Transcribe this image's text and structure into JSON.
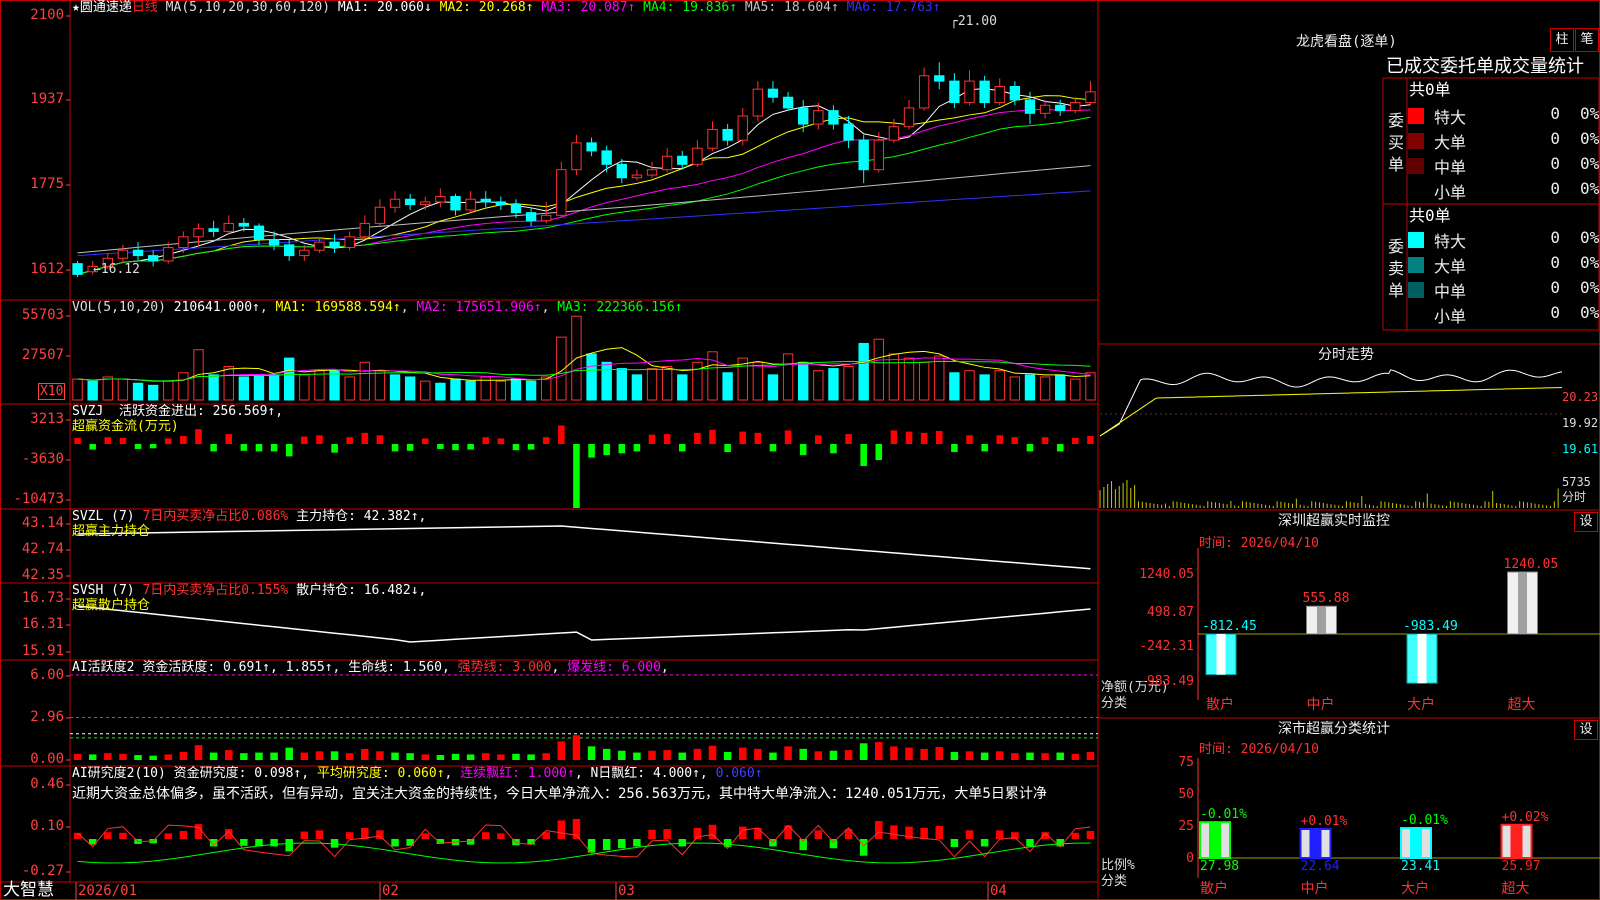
{
  "app": {
    "brand": "大智慧"
  },
  "stock": {
    "name": "★圆通速递",
    "period": "日线",
    "ma_label": "MA(5,10,20,30,60,120)",
    "ma_values": [
      {
        "key": "MA1",
        "value": "20.060",
        "dir": "down",
        "color": "#ffffff"
      },
      {
        "key": "MA2",
        "value": "20.268",
        "dir": "up",
        "color": "#ffff00"
      },
      {
        "key": "MA3",
        "value": "20.087",
        "dir": "up",
        "color": "#ff00ff"
      },
      {
        "key": "MA4",
        "value": "19.836",
        "dir": "up",
        "color": "#00ff00"
      },
      {
        "key": "MA5",
        "value": "18.604",
        "dir": "up",
        "color": "#c0c0c0"
      },
      {
        "key": "MA6",
        "value": "17.763",
        "dir": "up",
        "color": "#3030ff"
      }
    ],
    "high_marker": "21.00",
    "low_marker": "←16.12"
  },
  "colors": {
    "up": "#ff3030",
    "down": "#00ffff",
    "border": "#c00000",
    "yaxis": "#ff4040"
  },
  "panes": {
    "vol": {
      "label": "VOL(5,10,20)",
      "value": "210641.000↑",
      "ma1": "MA1: 169588.594↑",
      "ma2": "MA2: 175651.906↑",
      "ma3": "MA3: 222366.156↑",
      "unit": "X10"
    },
    "svzj": {
      "label": "SVZJ",
      "desc": "活跃资金进出: 256.569↑",
      "sub": "超赢资金流(万元)"
    },
    "svzl": {
      "label": "SVZL (7)",
      "desc": "7日内买卖净占比0.086%",
      "hold": "主力持仓: 42.382↑",
      "sub": "超赢主力持仓"
    },
    "svsh": {
      "label": "SVSH (7)",
      "desc": "7日内买卖净占比0.155%",
      "hold": "散户持仓: 16.482↓",
      "sub": "超赢散户持仓"
    },
    "ai1": {
      "label": "AI活跃度2",
      "desc": "资金活跃度: 0.691↑",
      "v2": "1.855",
      "v3": "生命线: 1.560",
      "v4": "强势线: 3.000",
      "v5": "爆发线: 6.000"
    },
    "ai2": {
      "label": "AI研究度2(10)",
      "desc": "资金研究度: 0.098↑",
      "v2": "平均研究度: 0.060↑",
      "v3": "连续飘红: 1.000↑",
      "v4": "N日飘红: 4.000↑",
      "v5": "0.060↑",
      "comment": "近期大资金总体偏多，虽不活跃，但有异动，宜关注大资金的持续性，今日大单净流入：256.563万元，其中特大单净流入：1240.051万元，大单5日累计净"
    }
  },
  "yaxis": {
    "price": [
      "2100",
      "1937",
      "1775",
      "1612"
    ],
    "vol": [
      "55703",
      "27507"
    ],
    "svzj": [
      "3213",
      "-3630",
      "-10473"
    ],
    "svzl": [
      "43.14",
      "42.74",
      "42.35"
    ],
    "svsh": [
      "16.73",
      "16.31",
      "15.91"
    ],
    "ai1": [
      "6.00",
      "2.96",
      "0.00"
    ],
    "ai2": [
      "0.46",
      "0.10",
      "-0.27"
    ]
  },
  "xaxis": [
    "2026/01",
    "02",
    "03",
    "04"
  ],
  "side": {
    "title": "龙虎看盘(逐单)",
    "btn_zhu": "柱",
    "btn_bi": "笔",
    "stats_header": "已成交委托单成交量统计",
    "buy": {
      "side_label": [
        "委",
        "买",
        "单"
      ],
      "total": "共0单",
      "rows": [
        {
          "label": "特大",
          "value": "0",
          "pct": "0%",
          "color": "#ff0000"
        },
        {
          "label": "大单",
          "value": "0",
          "pct": "0%",
          "color": "#800000"
        },
        {
          "label": "中单",
          "value": "0",
          "pct": "0%",
          "color": "#600000"
        },
        {
          "label": "小单",
          "value": "0",
          "pct": "0%",
          "color": "#000000"
        }
      ]
    },
    "sell": {
      "side_label": [
        "委",
        "卖",
        "单"
      ],
      "total": "共0单",
      "rows": [
        {
          "label": "特大",
          "value": "0",
          "pct": "0%",
          "color": "#00ffff"
        },
        {
          "label": "大单",
          "value": "0",
          "pct": "0%",
          "color": "#008080"
        },
        {
          "label": "中单",
          "value": "0",
          "pct": "0%",
          "color": "#006060"
        },
        {
          "label": "小单",
          "value": "0",
          "pct": "0%",
          "color": "#000000"
        }
      ]
    },
    "intraday": {
      "title": "分时走势",
      "y": [
        "20.23",
        "19.92",
        "19.61"
      ],
      "vol": "5735",
      "vol_unit": "分时"
    },
    "monitor": {
      "title": "深圳超赢实时监控",
      "btn": "设",
      "date": "时间: 2026/04/10",
      "y": [
        "1240.05",
        "498.87",
        "-242.31",
        "-983.49"
      ],
      "ylabel1": "净额(万元)",
      "ylabel2": "分类",
      "cats": [
        {
          "name": "散户",
          "value": -812.45,
          "label": "-812.45"
        },
        {
          "name": "中户",
          "value": 555.88,
          "label": "555.88"
        },
        {
          "name": "大户",
          "value": -983.49,
          "label": "-983.49"
        },
        {
          "name": "超大",
          "value": 1240.05,
          "label": "1240.05"
        }
      ]
    },
    "classify": {
      "title": "深市超赢分类统计",
      "btn": "设",
      "date": "时间: 2026/04/10",
      "y": [
        "75",
        "50",
        "25",
        "0"
      ],
      "ylabel1": "比例%",
      "ylabel2": "分类",
      "cats": [
        {
          "name": "散户",
          "value": 27.98,
          "chg": "-0.01%",
          "label": "27.98",
          "color": "#00ff00"
        },
        {
          "name": "中户",
          "value": 22.64,
          "chg": "+0.01%",
          "label": "22.64",
          "color": "#2020ff"
        },
        {
          "name": "大户",
          "value": 23.41,
          "chg": "-0.01%",
          "label": "23.41",
          "color": "#00ffff"
        },
        {
          "name": "超大",
          "value": 25.97,
          "chg": "+0.02%",
          "label": "25.97",
          "color": "#ff2020"
        }
      ]
    }
  },
  "chart_data": {
    "type": "candlestick",
    "title": "圆通速递 日线",
    "ylim": [
      16.12,
      21.0
    ],
    "candles": [
      [
        16.35,
        16.15,
        16.4,
        16.1
      ],
      [
        16.2,
        16.3,
        16.4,
        16.15
      ],
      [
        16.3,
        16.45,
        16.55,
        16.25
      ],
      [
        16.45,
        16.6,
        16.7,
        16.35
      ],
      [
        16.6,
        16.5,
        16.75,
        16.4
      ],
      [
        16.5,
        16.4,
        16.6,
        16.3
      ],
      [
        16.4,
        16.65,
        16.75,
        16.35
      ],
      [
        16.65,
        16.85,
        16.95,
        16.55
      ],
      [
        16.85,
        17.0,
        17.1,
        16.7
      ],
      [
        17.0,
        16.95,
        17.15,
        16.85
      ],
      [
        16.95,
        17.1,
        17.25,
        16.9
      ],
      [
        17.1,
        17.05,
        17.2,
        16.95
      ],
      [
        17.05,
        16.8,
        17.1,
        16.7
      ],
      [
        16.8,
        16.7,
        16.95,
        16.6
      ],
      [
        16.7,
        16.5,
        16.8,
        16.4
      ],
      [
        16.5,
        16.6,
        16.7,
        16.4
      ],
      [
        16.6,
        16.75,
        16.85,
        16.55
      ],
      [
        16.75,
        16.65,
        16.9,
        16.55
      ],
      [
        16.65,
        16.85,
        16.95,
        16.6
      ],
      [
        16.85,
        17.1,
        17.25,
        16.8
      ],
      [
        17.1,
        17.4,
        17.55,
        17.05
      ],
      [
        17.4,
        17.55,
        17.7,
        17.3
      ],
      [
        17.55,
        17.45,
        17.65,
        17.35
      ],
      [
        17.45,
        17.5,
        17.6,
        17.35
      ],
      [
        17.5,
        17.6,
        17.75,
        17.4
      ],
      [
        17.6,
        17.35,
        17.65,
        17.25
      ],
      [
        17.35,
        17.55,
        17.7,
        17.3
      ],
      [
        17.55,
        17.5,
        17.7,
        17.4
      ],
      [
        17.5,
        17.45,
        17.6,
        17.35
      ],
      [
        17.45,
        17.3,
        17.55,
        17.2
      ],
      [
        17.3,
        17.15,
        17.4,
        17.05
      ],
      [
        17.15,
        17.25,
        17.5,
        17.1
      ],
      [
        17.25,
        18.1,
        18.25,
        17.2
      ],
      [
        18.1,
        18.6,
        18.75,
        18.0
      ],
      [
        18.6,
        18.45,
        18.7,
        18.35
      ],
      [
        18.45,
        18.2,
        18.55,
        18.05
      ],
      [
        18.2,
        17.95,
        18.3,
        17.85
      ],
      [
        17.95,
        18.0,
        18.1,
        17.9
      ],
      [
        18.0,
        18.1,
        18.25,
        17.95
      ],
      [
        18.1,
        18.35,
        18.5,
        18.05
      ],
      [
        18.35,
        18.2,
        18.45,
        18.1
      ],
      [
        18.2,
        18.5,
        18.65,
        18.15
      ],
      [
        18.5,
        18.85,
        19.0,
        18.45
      ],
      [
        18.85,
        18.65,
        18.95,
        18.55
      ],
      [
        18.65,
        19.1,
        19.25,
        18.55
      ],
      [
        19.1,
        19.6,
        19.75,
        19.0
      ],
      [
        19.6,
        19.45,
        19.75,
        19.35
      ],
      [
        19.45,
        19.25,
        19.55,
        19.2
      ],
      [
        19.25,
        18.95,
        19.4,
        18.8
      ],
      [
        18.95,
        19.2,
        19.35,
        18.85
      ],
      [
        19.2,
        18.95,
        19.3,
        18.85
      ],
      [
        18.95,
        18.65,
        19.1,
        18.5
      ],
      [
        18.65,
        18.1,
        18.75,
        17.85
      ],
      [
        18.1,
        18.65,
        18.8,
        18.05
      ],
      [
        18.65,
        18.9,
        19.05,
        18.6
      ],
      [
        18.9,
        19.25,
        19.4,
        18.85
      ],
      [
        19.25,
        19.85,
        20.0,
        19.2
      ],
      [
        19.85,
        19.75,
        20.1,
        19.6
      ],
      [
        19.75,
        19.35,
        19.9,
        19.25
      ],
      [
        19.35,
        19.75,
        19.95,
        19.3
      ],
      [
        19.75,
        19.35,
        19.85,
        19.25
      ],
      [
        19.35,
        19.65,
        19.8,
        19.3
      ],
      [
        19.65,
        19.4,
        19.75,
        19.3
      ],
      [
        19.4,
        19.15,
        19.55,
        18.95
      ],
      [
        19.15,
        19.3,
        19.4,
        19.05
      ],
      [
        19.3,
        19.2,
        19.4,
        19.1
      ],
      [
        19.2,
        19.35,
        19.45,
        19.15
      ],
      [
        19.35,
        19.55,
        19.75,
        19.3
      ]
    ],
    "volumes": [
      [
        10,
        1
      ],
      [
        9,
        0
      ],
      [
        11,
        1
      ],
      [
        10,
        1
      ],
      [
        8,
        0
      ],
      [
        7,
        0
      ],
      [
        9,
        1
      ],
      [
        13,
        1
      ],
      [
        24,
        1
      ],
      [
        12,
        0
      ],
      [
        16,
        1
      ],
      [
        11,
        0
      ],
      [
        12,
        0
      ],
      [
        12,
        0
      ],
      [
        20,
        0
      ],
      [
        12,
        1
      ],
      [
        14,
        1
      ],
      [
        14,
        0
      ],
      [
        11,
        1
      ],
      [
        18,
        1
      ],
      [
        14,
        1
      ],
      [
        12,
        0
      ],
      [
        11,
        0
      ],
      [
        9,
        1
      ],
      [
        8,
        0
      ],
      [
        10,
        0
      ],
      [
        9,
        0
      ],
      [
        11,
        1
      ],
      [
        9,
        1
      ],
      [
        10,
        0
      ],
      [
        9,
        0
      ],
      [
        11,
        1
      ],
      [
        30,
        1
      ],
      [
        40,
        1
      ],
      [
        22,
        0
      ],
      [
        18,
        0
      ],
      [
        15,
        0
      ],
      [
        12,
        0
      ],
      [
        15,
        1
      ],
      [
        16,
        1
      ],
      [
        12,
        0
      ],
      [
        18,
        1
      ],
      [
        23,
        1
      ],
      [
        13,
        0
      ],
      [
        20,
        1
      ],
      [
        18,
        1
      ],
      [
        12,
        0
      ],
      [
        22,
        1
      ],
      [
        18,
        0
      ],
      [
        14,
        1
      ],
      [
        15,
        0
      ],
      [
        16,
        1
      ],
      [
        27,
        0
      ],
      [
        29,
        1
      ],
      [
        22,
        1
      ],
      [
        20,
        1
      ],
      [
        18,
        1
      ],
      [
        21,
        1
      ],
      [
        13,
        0
      ],
      [
        14,
        1
      ],
      [
        12,
        0
      ],
      [
        14,
        1
      ],
      [
        11,
        1
      ],
      [
        12,
        0
      ],
      [
        11,
        1
      ],
      [
        12,
        0
      ],
      [
        10,
        1
      ],
      [
        13,
        1
      ]
    ]
  }
}
